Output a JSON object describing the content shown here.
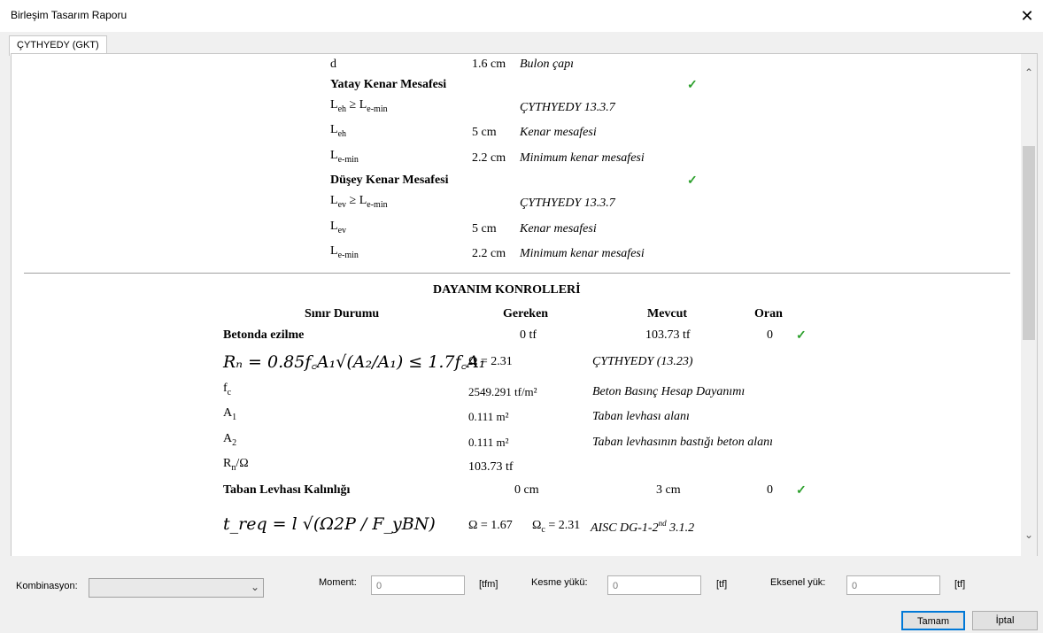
{
  "window": {
    "title": "Birleşim Tasarım Raporu",
    "close_glyph": "✕"
  },
  "tab": {
    "label": "ÇYTHYEDY (GKT)"
  },
  "report": {
    "d_row": {
      "symbol": "d",
      "value": "1.6 cm",
      "desc": "Bulon çapı"
    },
    "yatay": {
      "heading": "Yatay Kenar Mesafesi",
      "check": "✓",
      "cond": {
        "L1": "L",
        "s1": "eh",
        "op": " ≥ ",
        "L2": "L",
        "s2": "e-min",
        "ref": "ÇYTHYEDY 13.3.7"
      },
      "leh": {
        "L": "L",
        "s": "eh",
        "value": "5 cm",
        "desc": "Kenar mesafesi"
      },
      "lemin": {
        "L": "L",
        "s": "e-min",
        "value": "2.2 cm",
        "desc": "Minimum kenar mesafesi"
      }
    },
    "dusey": {
      "heading": "Düşey Kenar Mesafesi",
      "check": "✓",
      "cond": {
        "L1": "L",
        "s1": "ev",
        "op": " ≥ ",
        "L2": "L",
        "s2": "e-min",
        "ref": "ÇYTHYEDY 13.3.7"
      },
      "lev": {
        "L": "L",
        "s": "ev",
        "value": "5 cm",
        "desc": "Kenar mesafesi"
      },
      "lemin": {
        "L": "L",
        "s": "e-min",
        "value": "2.2 cm",
        "desc": "Minimum kenar mesafesi"
      }
    },
    "dayanim": {
      "heading": "DAYANIM KONROLLERİ",
      "cols": {
        "c1": "Sınır Durumu",
        "c2": "Gereken",
        "c3": "Mevcut",
        "c4": "Oran"
      },
      "betonda": {
        "label": "Betonda ezilme",
        "gereken": "0 tf",
        "mevcut": "103.73 tf",
        "oran": "0",
        "check": "✓"
      },
      "rn_formula": {
        "text": "Rₙ = 0.85f꜀A₁√(A₂/A₁) ≤ 1.7f꜀A₁",
        "omega": "Ω = 2.31",
        "ref": "ÇYTHYEDY (13.23)"
      },
      "fc": {
        "sym": "f",
        "sub": "c",
        "value": "2549.291 tf/m²",
        "desc": "Beton Basınç Hesap Dayanımı"
      },
      "a1": {
        "sym": "A",
        "sub": "1",
        "value": "0.111 m²",
        "desc": "Taban levhası alanı"
      },
      "a2": {
        "sym": "A",
        "sub": "2",
        "value": "0.111 m²",
        "desc": "Taban levhasının bastığı beton alanı"
      },
      "rn_omega": {
        "sym": "R",
        "sub": "n",
        "tail": "/Ω",
        "value": "103.73 tf"
      },
      "taban": {
        "label": "Taban Levhası Kalınlığı",
        "gereken": "0 cm",
        "mevcut": "3 cm",
        "oran": "0",
        "check": "✓"
      },
      "treq": {
        "text": "t_req = l √(Ω2P / F_yBN)",
        "omega": "Ω = 1.67",
        "omega_c": "Ω",
        "omega_c_sub": "c",
        "omega_c_val": " = 2.31",
        "ref": "AISC DG-1-2",
        "ref_sup": "nd",
        "ref_tail": " 3.1.2"
      }
    }
  },
  "scroll": {
    "up": "⌃",
    "down": "⌄"
  },
  "bottom": {
    "kombinasyon_label": "Kombinasyon:",
    "moment_label": "Moment:",
    "moment_value": "0",
    "moment_unit": "[tfm]",
    "kesme_label": "Kesme yükü:",
    "kesme_value": "0",
    "kesme_unit": "[tf]",
    "eksenel_label": "Eksenel yük:",
    "eksenel_value": "0",
    "eksenel_unit": "[tf]",
    "ok": "Tamam",
    "cancel": "İptal"
  }
}
